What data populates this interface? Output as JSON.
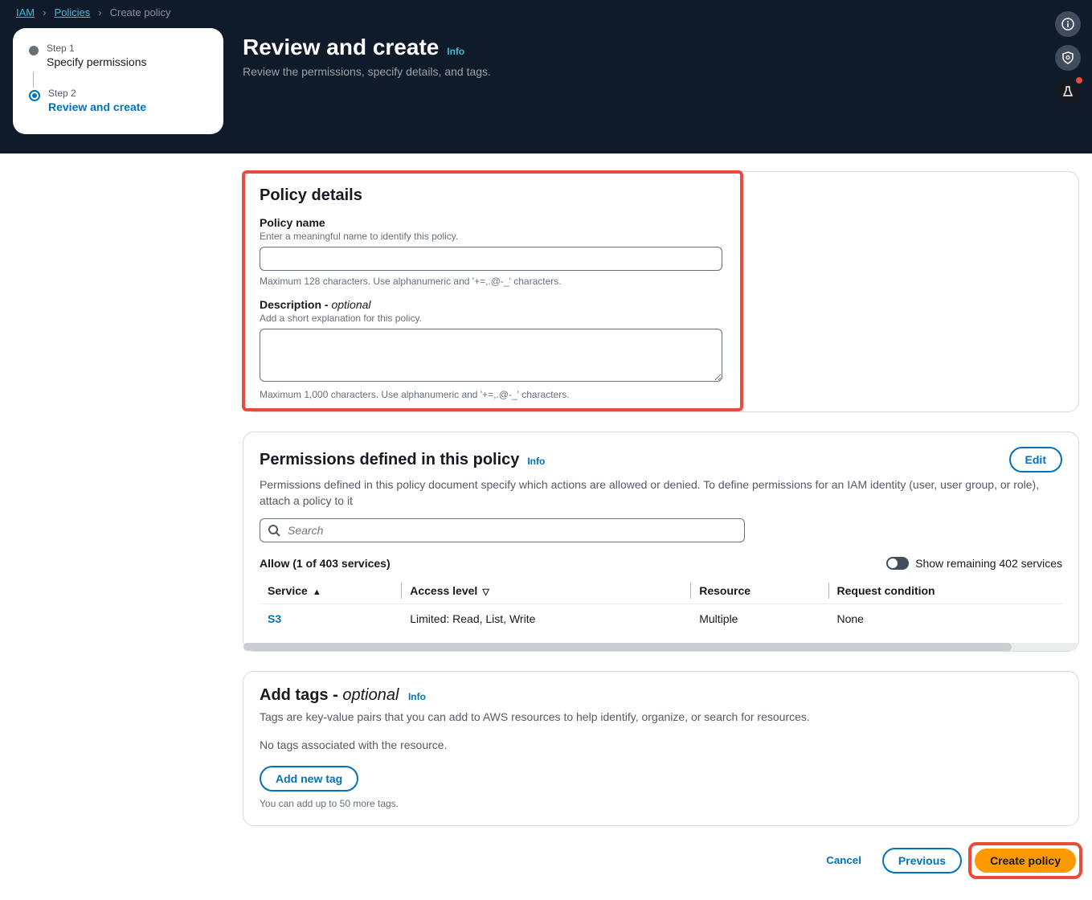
{
  "breadcrumb": {
    "iam": "IAM",
    "policies": "Policies",
    "current": "Create policy"
  },
  "sidebar": {
    "step1_label": "Step 1",
    "step1_title": "Specify permissions",
    "step2_label": "Step 2",
    "step2_title": "Review and create"
  },
  "header": {
    "title": "Review and create",
    "info": "Info",
    "subtitle": "Review the permissions, specify details, and tags."
  },
  "details": {
    "panel_title": "Policy details",
    "name_label": "Policy name",
    "name_hint": "Enter a meaningful name to identify this policy.",
    "name_constraint": "Maximum 128 characters. Use alphanumeric and '+=,.@-_' characters.",
    "desc_label": "Description - ",
    "desc_optional": "optional",
    "desc_hint": "Add a short explanation for this policy.",
    "desc_constraint": "Maximum 1,000 characters. Use alphanumeric and '+=,.@-_' characters."
  },
  "permissions": {
    "panel_title": "Permissions defined in this policy",
    "info": "Info",
    "edit": "Edit",
    "desc": "Permissions defined in this policy document specify which actions are allowed or denied. To define permissions for an IAM identity (user, user group, or role), attach a policy to it",
    "search_placeholder": "Search",
    "allow_label": "Allow (1 of 403 services)",
    "toggle_label": "Show remaining 402 services",
    "cols": {
      "service": "Service",
      "access": "Access level",
      "resource": "Resource",
      "condition": "Request condition"
    },
    "rows": [
      {
        "service": "S3",
        "access": "Limited: Read, List, Write",
        "resource": "Multiple",
        "condition": "None"
      }
    ]
  },
  "tags": {
    "panel_title": "Add tags - ",
    "optional": "optional",
    "info": "Info",
    "desc": "Tags are key-value pairs that you can add to AWS resources to help identify, organize, or search for resources.",
    "empty": "No tags associated with the resource.",
    "add_btn": "Add new tag",
    "limit": "You can add up to 50 more tags."
  },
  "footer": {
    "cancel": "Cancel",
    "previous": "Previous",
    "create": "Create policy"
  }
}
